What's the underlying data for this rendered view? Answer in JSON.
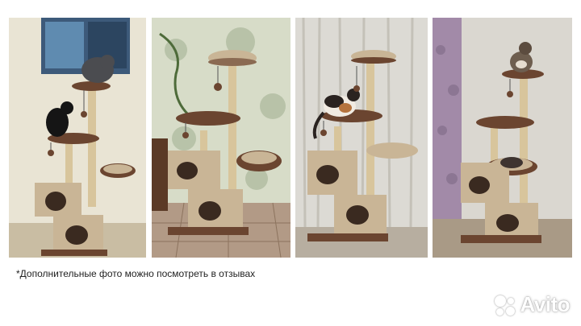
{
  "photos": [
    {
      "name": "cat-tree-photo-1",
      "subject": "cat tree with two dark cats, painting on wall"
    },
    {
      "name": "cat-tree-photo-2",
      "subject": "cat tree with hammock, patterned wallpaper, tiled floor"
    },
    {
      "name": "cat-tree-photo-3",
      "subject": "cat tree with calico cat, white curtain"
    },
    {
      "name": "cat-tree-photo-4",
      "subject": "cat tree with tabby cat on top, lilac curtain"
    }
  ],
  "note": {
    "text": "*Дополнительные фото можно посмотреть в отзывах"
  },
  "watermark": {
    "brand": "Avito"
  },
  "colors": {
    "brown": "#6b4530",
    "beige": "#c9b596",
    "sisal": "#d8c59c"
  }
}
